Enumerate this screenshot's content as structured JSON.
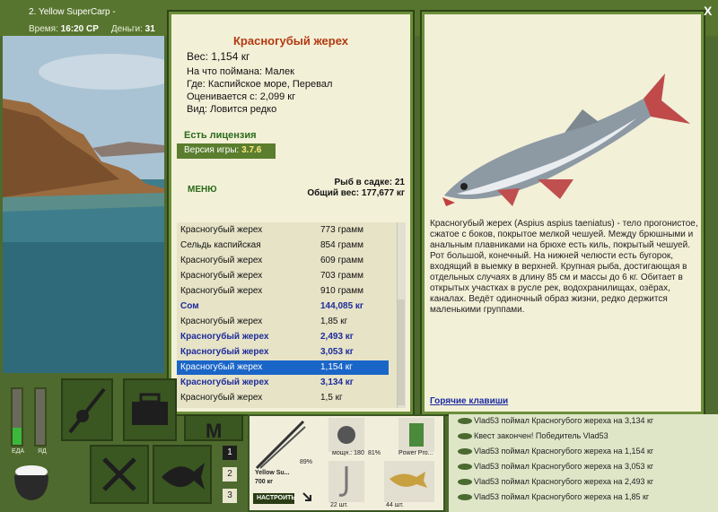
{
  "window": {
    "title": "2. Yellow SuperCarp -",
    "time_label": "Время:",
    "time_value": "16:20 СР",
    "money_label": "Деньги:",
    "money_value": "31"
  },
  "close_label": "X",
  "fish_card": {
    "name": "Красногубый жерех",
    "weight": "Вес: 1,154 кг",
    "caught_on": "На что поймана: Малек",
    "location": "Где: Каспийское море, Перевал",
    "valued_from": "Оценивается с: 2,099 кг",
    "species_rarity": "Вид: Ловится редко",
    "license": "Есть лицензия",
    "version_label": "Версия игры:",
    "version_value": "3.7.6",
    "menu_label": "МЕНЮ",
    "fish_in_net": "Рыб в садке: 21",
    "total_weight": "Общий вес: 177,677 кг"
  },
  "catch_list": [
    {
      "name": "Красногубый жерех",
      "weight": "773 грамм",
      "big": false,
      "selected": false
    },
    {
      "name": "Сельдь каспийская",
      "weight": "854 грамм",
      "big": false,
      "selected": false
    },
    {
      "name": "Красногубый жерех",
      "weight": "609 грамм",
      "big": false,
      "selected": false
    },
    {
      "name": "Красногубый жерех",
      "weight": "703 грамм",
      "big": false,
      "selected": false
    },
    {
      "name": "Красногубый жерех",
      "weight": "910 грамм",
      "big": false,
      "selected": false
    },
    {
      "name": "Сом",
      "weight": "144,085 кг",
      "big": true,
      "selected": false
    },
    {
      "name": "Красногубый жерех",
      "weight": "1,85 кг",
      "big": false,
      "selected": false
    },
    {
      "name": "Красногубый жерех",
      "weight": "2,493 кг",
      "big": true,
      "selected": false
    },
    {
      "name": "Красногубый жерех",
      "weight": "3,053 кг",
      "big": true,
      "selected": false
    },
    {
      "name": "Красногубый жерех",
      "weight": "1,154 кг",
      "big": false,
      "selected": true
    },
    {
      "name": "Красногубый жерех",
      "weight": "3,134 кг",
      "big": true,
      "selected": false
    },
    {
      "name": "Красногубый жерех",
      "weight": "1,5 кг",
      "big": false,
      "selected": false
    }
  ],
  "description": "Красногубый жерех (Aspius aspius taeniatus) - тело прогонистое, сжатое с боков, покрытое мелкой чешуей. Между брюшными и анальным плавниками на брюхе есть киль, покрытый чешуей. Рот большой, конечный. На нижней челюсти есть бугорок, входящий в выемку в верхней. Крупная рыба, достигающая в отдельных случаях в длину 85 см и массы до 6 кг. Обитает в открытых участках в русле рек, водохранилищах, озёрах, каналах. Ведёт одиночный образ жизни, редко держится маленькими группами.",
  "hotkeys_label": "Горячие клавиши",
  "gauges": {
    "food_label": "ЕДА",
    "poison_label": "ЯД",
    "food_level": 0.3,
    "poison_level": 0.0
  },
  "tabs": [
    "1",
    "2",
    "3"
  ],
  "tray": {
    "rod_name": "Yellow Su...",
    "rod_length": "700 кг",
    "rod_pct": "89%",
    "power_label": "мощн.: 180",
    "power_pct": "81%",
    "lure_name": "Power Pro...",
    "setup_label": "НАСТРОИТЬ",
    "hook_count": "22 шт.",
    "bait_count": "44 шт."
  },
  "chat": [
    "Vlad53 поймал Красногубого жереха на 3,134 кг",
    "Квест закончен! Победитель Vlad53",
    "Vlad53 поймал Красногубого жереха на 1,154 кг",
    "Vlad53 поймал Красногубого жереха на 3,053 кг",
    "Vlad53 поймал Красногубого жереха на 2,493 кг",
    "Vlad53 поймал Красногубого жереха на 1,85 кг"
  ],
  "colors": {
    "accent_green": "#5a7e2e",
    "fish_title": "#b23a10",
    "big_catch": "#1e2c9a",
    "selection": "#1a66c8"
  }
}
